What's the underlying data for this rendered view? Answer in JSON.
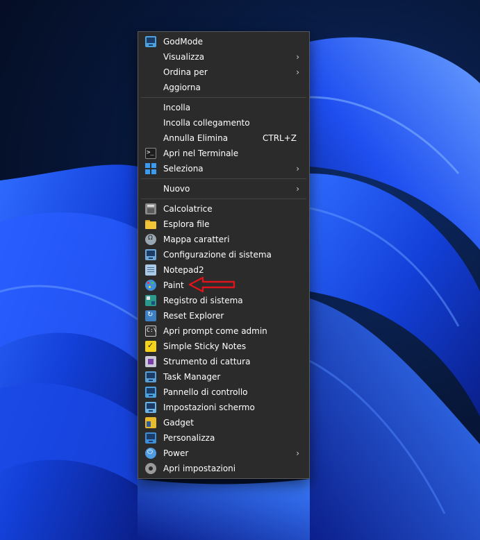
{
  "menu": {
    "items": [
      {
        "label": "GodMode",
        "icon": "godmode-icon",
        "color": "#4aa3e0"
      },
      {
        "label": "Visualizza",
        "submenu": true
      },
      {
        "label": "Ordina per",
        "submenu": true
      },
      {
        "label": "Aggiorna"
      },
      {
        "label": "Incolla"
      },
      {
        "label": "Incolla collegamento"
      },
      {
        "label": "Annulla Elimina",
        "shortcut": "CTRL+Z"
      },
      {
        "label": "Apri nel Terminale",
        "icon": "terminal-icon",
        "color": "#1e1e1e"
      },
      {
        "label": "Seleziona",
        "icon": "select-grid-icon",
        "color": "#3b9bf0",
        "submenu": true
      },
      {
        "label": "Nuovo",
        "submenu": true
      },
      {
        "label": "Calcolatrice",
        "icon": "calculator-icon",
        "color": "#8a8a8a"
      },
      {
        "label": "Esplora file",
        "icon": "folder-icon",
        "color": "#f2c438"
      },
      {
        "label": "Mappa caratteri",
        "icon": "character-map-icon",
        "color": "#9aa6b2"
      },
      {
        "label": "Configurazione di sistema",
        "icon": "system-config-icon",
        "color": "#6fa7d6"
      },
      {
        "label": "Notepad2",
        "icon": "notepad-icon",
        "color": "#a9c9e8"
      },
      {
        "label": "Paint",
        "icon": "paint-palette-icon",
        "color": "#3f8fd9"
      },
      {
        "label": "Registro di sistema",
        "icon": "registry-icon",
        "color": "#2a9a8c"
      },
      {
        "label": "Reset Explorer",
        "icon": "reset-explorer-icon",
        "color": "#3d7fc4"
      },
      {
        "label": "Apri prompt come admin",
        "icon": "command-prompt-icon",
        "color": "#333333"
      },
      {
        "label": "Simple Sticky Notes",
        "icon": "sticky-notes-icon",
        "color": "#f2d21b"
      },
      {
        "label": "Strumento di cattura",
        "icon": "snipping-tool-icon",
        "color": "#c9c9d8"
      },
      {
        "label": "Task Manager",
        "icon": "task-manager-icon",
        "color": "#5aa0d8"
      },
      {
        "label": "Pannello di controllo",
        "icon": "control-panel-icon",
        "color": "#4aa3e0"
      },
      {
        "label": "Impostazioni schermo",
        "icon": "display-icon",
        "color": "#6cb4e8"
      },
      {
        "label": "Gadget",
        "icon": "gadget-icon",
        "color": "#e8b92a"
      },
      {
        "label": "Personalizza",
        "icon": "personalize-icon",
        "color": "#3c8fd8"
      },
      {
        "label": "Power",
        "icon": "power-icon",
        "color": "#4f9de2",
        "submenu": true
      },
      {
        "label": "Apri impostazioni",
        "icon": "settings-gear-icon",
        "color": "#9a9a9a"
      }
    ],
    "chevron": "›"
  },
  "annotation": {
    "color": "#e0141a"
  }
}
